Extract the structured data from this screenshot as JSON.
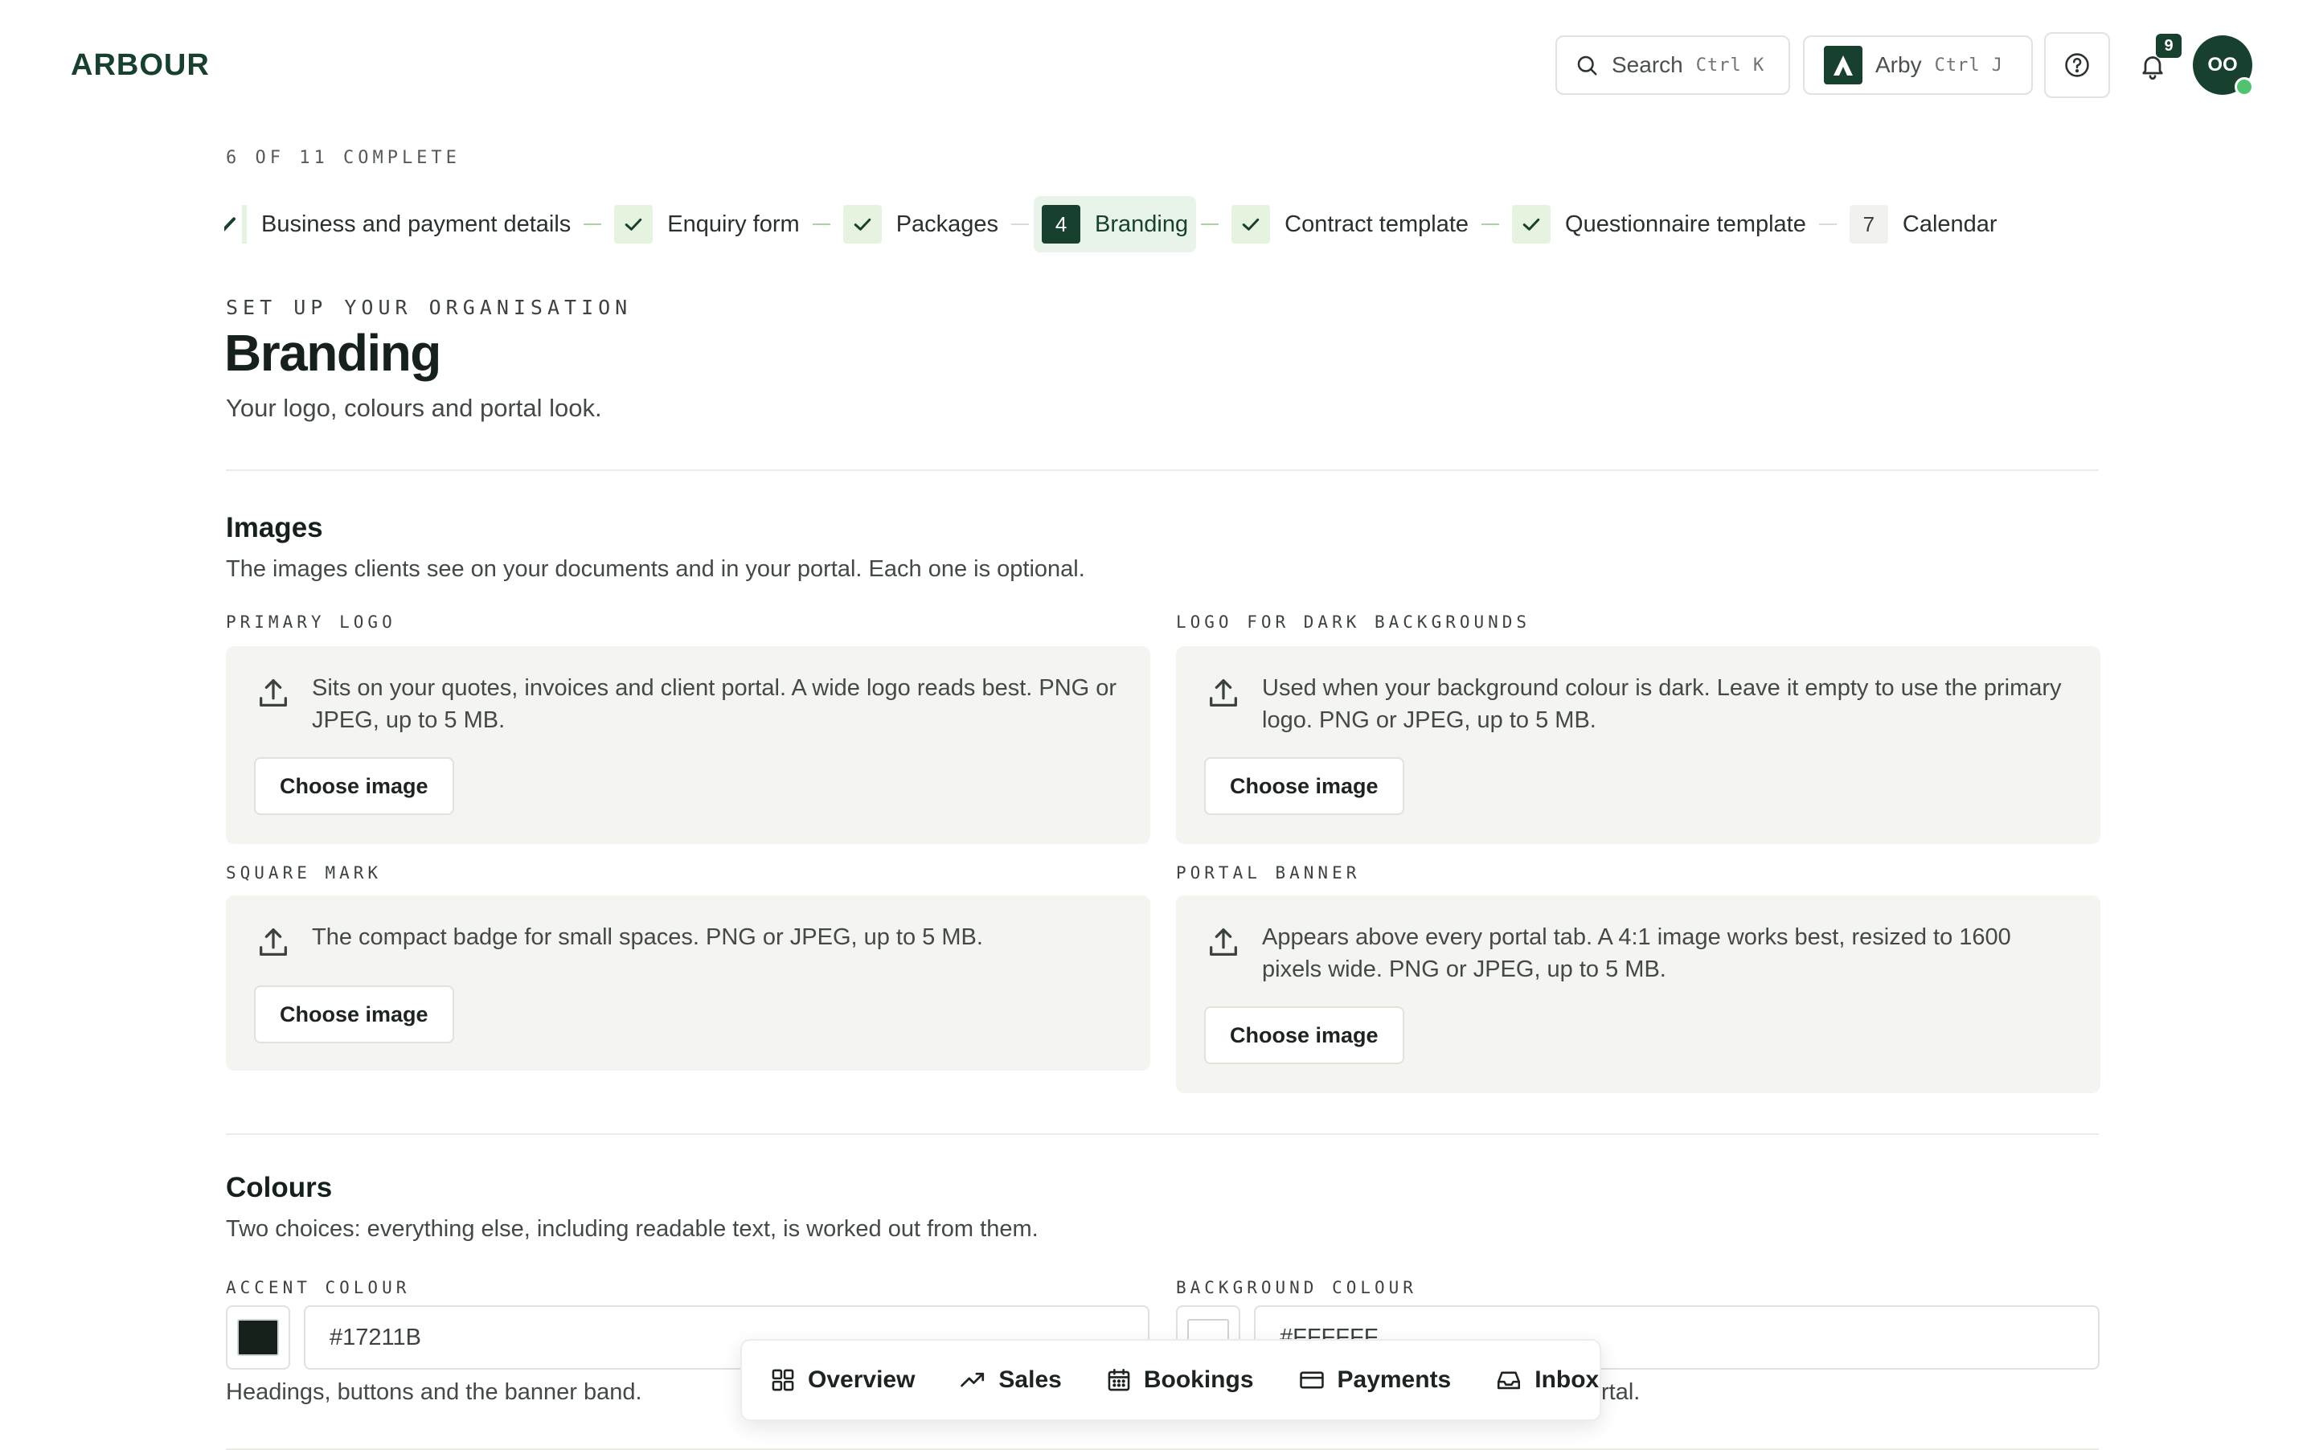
{
  "brand": {
    "name": "ARBOUR"
  },
  "topbar": {
    "search_label": "Search",
    "search_shortcut": "Ctrl K",
    "assistant_label": "Arby",
    "assistant_shortcut": "Ctrl J",
    "notifications_count": "9",
    "avatar_initials": "OO"
  },
  "progress": {
    "text": "6 OF 11 COMPLETE",
    "steps": [
      {
        "label": "Business and payment details",
        "status": "done",
        "number": ""
      },
      {
        "label": "Enquiry form",
        "status": "done",
        "number": ""
      },
      {
        "label": "Packages",
        "status": "done",
        "number": ""
      },
      {
        "label": "Branding",
        "status": "current",
        "number": "4"
      },
      {
        "label": "Contract template",
        "status": "done",
        "number": ""
      },
      {
        "label": "Questionnaire template",
        "status": "done",
        "number": ""
      },
      {
        "label": "Calendar",
        "status": "todo",
        "number": "7"
      }
    ]
  },
  "page": {
    "eyebrow": "SET UP YOUR ORGANISATION",
    "title": "Branding",
    "subtitle": "Your logo, colours and portal look."
  },
  "images": {
    "title": "Images",
    "description": "The images clients see on your documents and in your portal. Each one is optional.",
    "choose_label": "Choose image",
    "primary_logo": {
      "label": "PRIMARY LOGO",
      "description": "Sits on your quotes, invoices and client portal. A wide logo reads best. PNG or JPEG, up to 5 MB."
    },
    "dark_logo": {
      "label": "LOGO FOR DARK BACKGROUNDS",
      "description": "Used when your background colour is dark. Leave it empty to use the primary logo. PNG or JPEG, up to 5 MB."
    },
    "square_mark": {
      "label": "SQUARE MARK",
      "description": "The compact badge for small spaces. PNG or JPEG, up to 5 MB."
    },
    "portal_banner": {
      "label": "PORTAL BANNER",
      "description": "Appears above every portal tab. A 4:1 image works best, resized to 1600 pixels wide. PNG or JPEG, up to 5 MB."
    }
  },
  "colours": {
    "title": "Colours",
    "description": "Two choices: everything else, including readable text, is worked out from them.",
    "accent": {
      "label": "ACCENT COLOUR",
      "value": "#17211B",
      "helper": "Headings, buttons and the banner band."
    },
    "background": {
      "label": "BACKGROUND COLOUR",
      "value": "#FFFFFF",
      "helper_visible_tail": "rtal."
    }
  },
  "bottom_nav": {
    "items": [
      {
        "label": "Overview",
        "icon": "grid-icon"
      },
      {
        "label": "Sales",
        "icon": "trend-up-icon"
      },
      {
        "label": "Bookings",
        "icon": "calendar-icon"
      },
      {
        "label": "Payments",
        "icon": "card-icon"
      },
      {
        "label": "Inbox",
        "icon": "inbox-icon"
      }
    ]
  },
  "theme": {
    "accent": "#17402f",
    "done_check": "#17402f",
    "canvas": "#f4f4f0"
  }
}
